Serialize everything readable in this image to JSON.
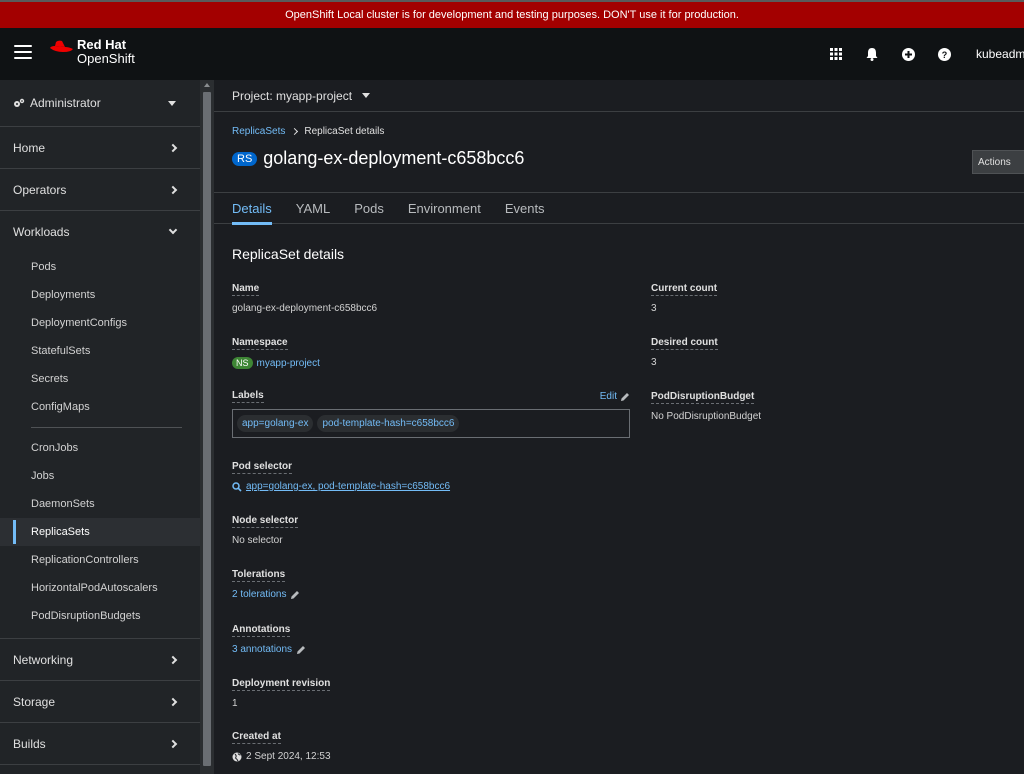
{
  "banner": {
    "text": "OpenShift Local cluster is for development and testing purposes. DON'T use it for production."
  },
  "masthead": {
    "logo_line1": "Red Hat",
    "logo_line2": "OpenShift",
    "icons": [
      "app-launcher-icon",
      "bell-icon",
      "plus-circle-icon",
      "help-icon"
    ],
    "user": "kubeadmin"
  },
  "sidebar": {
    "perspective": "Administrator",
    "sections_top": [
      {
        "label": "Home"
      },
      {
        "label": "Operators"
      }
    ],
    "workloads": {
      "label": "Workloads",
      "items_group1": [
        "Pods",
        "Deployments",
        "DeploymentConfigs",
        "StatefulSets",
        "Secrets",
        "ConfigMaps"
      ],
      "items_group2": [
        "CronJobs",
        "Jobs",
        "DaemonSets",
        "ReplicaSets",
        "ReplicationControllers",
        "HorizontalPodAutoscalers",
        "PodDisruptionBudgets"
      ],
      "active": "ReplicaSets"
    },
    "sections_bottom": [
      {
        "label": "Networking"
      },
      {
        "label": "Storage"
      },
      {
        "label": "Builds"
      }
    ]
  },
  "project": {
    "label": "Project: myapp-project"
  },
  "breadcrumb": {
    "parent": "ReplicaSets",
    "current": "ReplicaSet details"
  },
  "header": {
    "badge": "RS",
    "title": "golang-ex-deployment-c658bcc6",
    "actions": "Actions"
  },
  "tabs": [
    "Details",
    "YAML",
    "Pods",
    "Environment",
    "Events"
  ],
  "active_tab": "Details",
  "details": {
    "section_title": "ReplicaSet details",
    "name_label": "Name",
    "name_value": "golang-ex-deployment-c658bcc6",
    "namespace_label": "Namespace",
    "namespace_badge": "NS",
    "namespace_value": "myapp-project",
    "labels_label": "Labels",
    "labels_edit": "Edit",
    "labels": [
      "app=golang-ex",
      "pod-template-hash=c658bcc6"
    ],
    "pod_selector_label": "Pod selector",
    "pod_selector_value": "app=golang-ex, pod-template-hash=c658bcc6",
    "node_selector_label": "Node selector",
    "node_selector_value": "No selector",
    "tolerations_label": "Tolerations",
    "tolerations_value": "2 tolerations",
    "annotations_label": "Annotations",
    "annotations_value": "3 annotations",
    "revision_label": "Deployment revision",
    "revision_value": "1",
    "created_label": "Created at",
    "created_value": "2 Sept 2024, 12:53",
    "current_count_label": "Current count",
    "current_count_value": "3",
    "desired_count_label": "Desired count",
    "desired_count_value": "3",
    "pdb_label": "PodDisruptionBudget",
    "pdb_value": "No PodDisruptionBudget"
  },
  "colors": {
    "banner": "#a30000",
    "link": "#73bcf7",
    "ns_badge": "#3e8635",
    "rs_badge": "#0066cc"
  }
}
